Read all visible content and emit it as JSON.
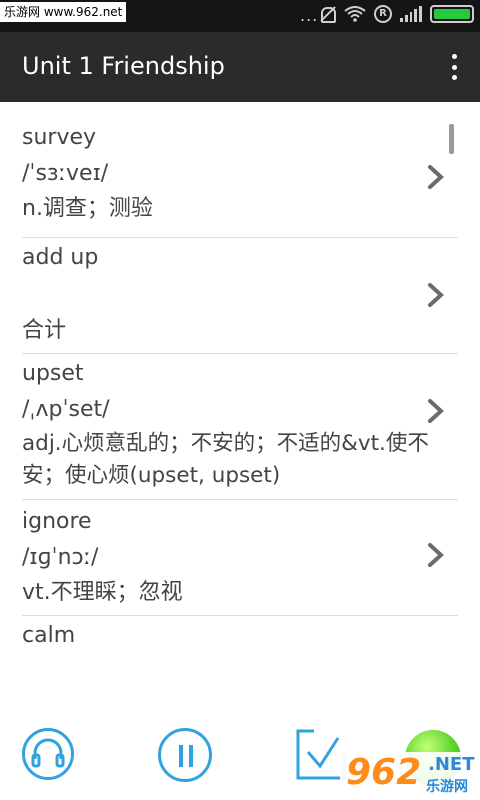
{
  "status_bar": {
    "watermark_text": "乐游网 www.962.net",
    "dots": "...",
    "icons": [
      "mute-bell-icon",
      "wifi-icon",
      "r-badge-icon",
      "signal-icon",
      "battery-icon"
    ],
    "r_label": "R"
  },
  "action_bar": {
    "title": "Unit 1 Friendship",
    "menu_icon": "overflow-menu-icon"
  },
  "entries": [
    {
      "word": "survey",
      "phonetic": "/ˈsɜːveɪ/",
      "meaning": "n.调查；测验"
    },
    {
      "word": "add up",
      "phonetic": "",
      "meaning": "合计"
    },
    {
      "word": "upset",
      "phonetic": "/ˌʌpˈset/",
      "meaning": "adj.心烦意乱的；不安的；不适的&vt.使不安；使心烦(upset, upset)"
    },
    {
      "word": "ignore",
      "phonetic": "/ɪɡˈnɔː/",
      "meaning": "vt.不理睬；忽视"
    },
    {
      "word": "calm",
      "phonetic": "",
      "meaning": ""
    }
  ],
  "controls": {
    "icons": [
      "headphones-icon",
      "pause-icon",
      "download-icon",
      "green-ball-icon"
    ]
  },
  "watermark": {
    "number": "962",
    "net": ".NET",
    "cn": "乐游网"
  },
  "colors": {
    "accent": "#2fa3e0",
    "action_bar_bg": "#2b2b2b",
    "status_bar_bg": "#151515",
    "text": "#444444",
    "battery": "#27c93f"
  }
}
